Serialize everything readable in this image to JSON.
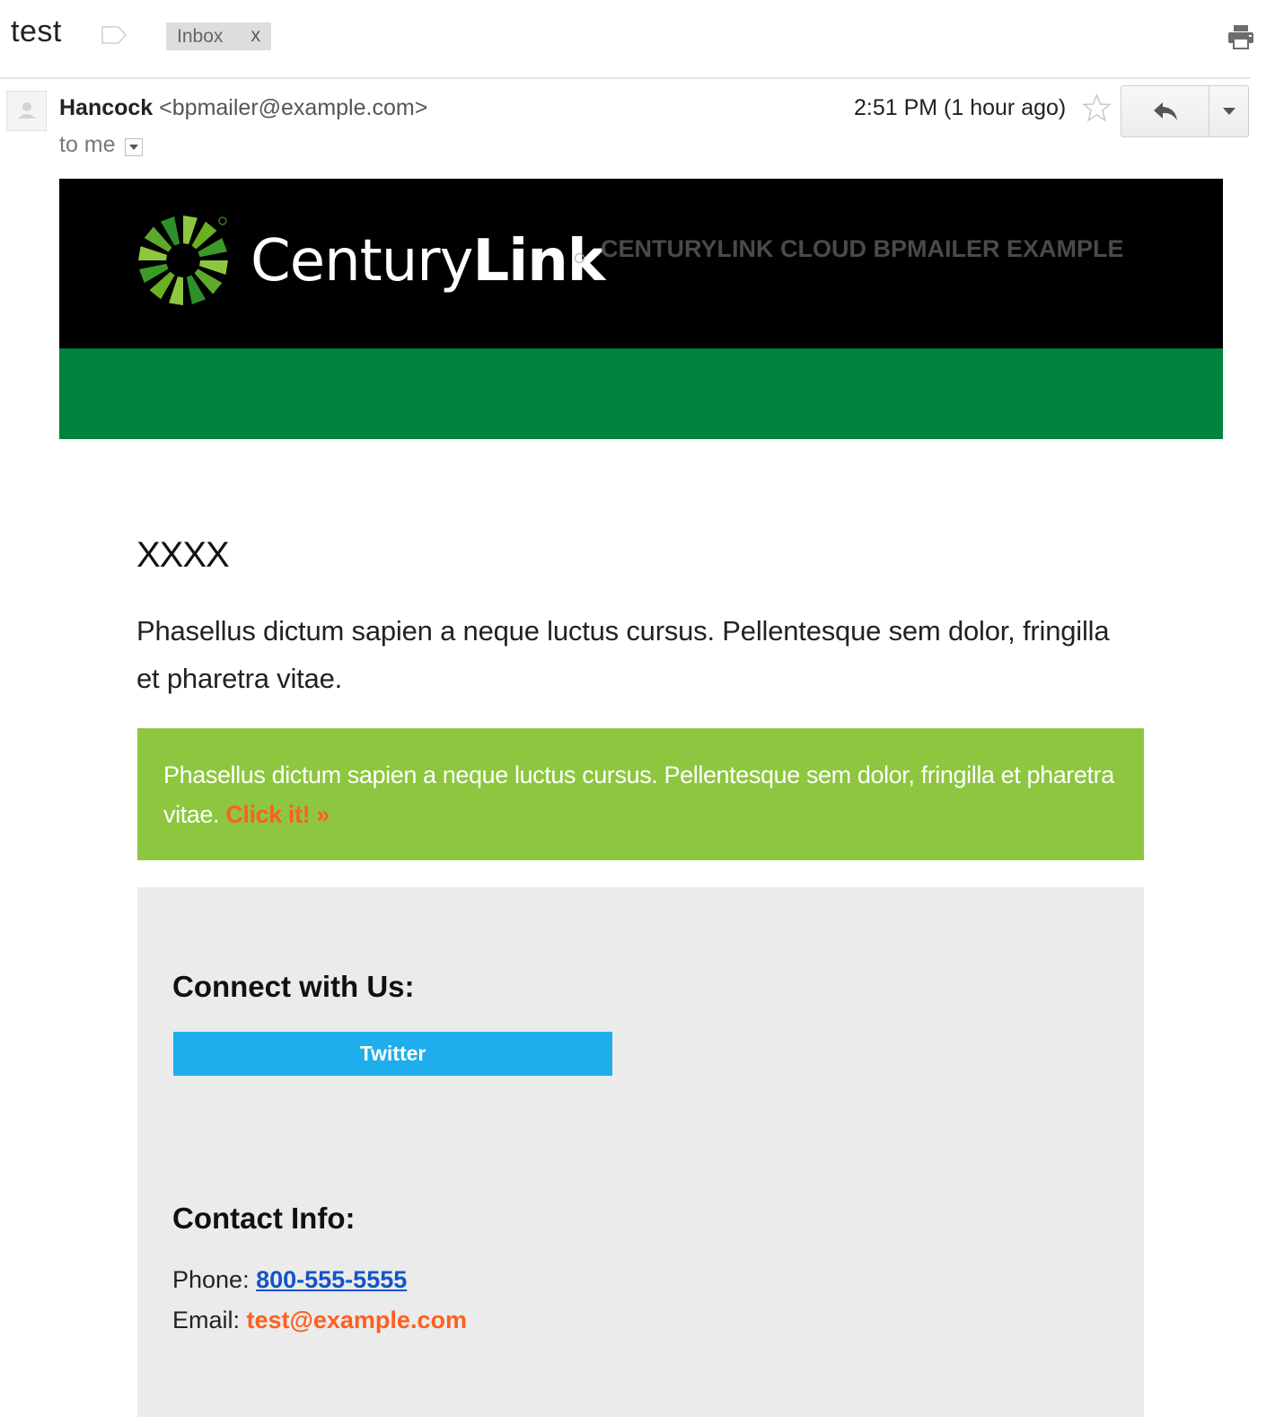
{
  "subject_bar": {
    "title": "test",
    "label_chip": "Inbox",
    "label_chip_close": "x"
  },
  "message_header": {
    "sender_name": "Hancock",
    "sender_email": "<bpmailer@example.com>",
    "recipient": "to me",
    "timestamp": "2:51 PM (1 hour ago)",
    "icons": {
      "avatar": "person-avatar",
      "star": "star-icon",
      "reply": "reply-icon",
      "more": "chevron-down-icon",
      "print": "print-icon",
      "label": "label-tag-icon"
    }
  },
  "email": {
    "banner": {
      "logo_text_light": "Century",
      "logo_text_bold": "Link",
      "tagline": "CENTURYLINK CLOUD BPMAILER EXAMPLE"
    },
    "heading": "XXXX",
    "paragraph": "Phasellus dictum sapien a neque luctus cursus. Pellentesque sem dolor, fringilla et pharetra vitae.",
    "callout": {
      "text": "Phasellus dictum sapien a neque luctus cursus. Pellentesque sem dolor, fringilla et pharetra vitae.",
      "link_label": "Click it! »"
    },
    "footer": {
      "connect_heading": "Connect with Us:",
      "twitter_label": "Twitter",
      "contact_heading": "Contact Info:",
      "phone_label": "Phone:",
      "phone_value": "800-555-5555",
      "email_label": "Email:",
      "email_value": "test@example.com"
    }
  },
  "colors": {
    "banner_black": "#000000",
    "banner_green": "#00843d",
    "callout_green": "#8dc63f",
    "accent_orange": "#ff5f1f",
    "twitter_blue": "#1eaeeb",
    "footer_gray": "#ebebeb",
    "link_blue": "#1155cc"
  }
}
